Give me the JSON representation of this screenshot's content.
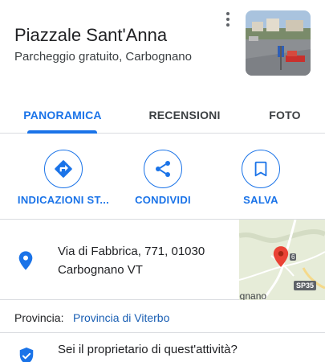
{
  "place": {
    "title": "Piazzale Sant'Anna",
    "subtitle": "Parcheggio gratuito, Carbognano"
  },
  "tabs": [
    {
      "label": "PANORAMICA",
      "active": true
    },
    {
      "label": "RECENSIONI",
      "active": false
    },
    {
      "label": "FOTO",
      "active": false
    }
  ],
  "actions": [
    {
      "label": "INDICAZIONI ST...",
      "icon": "directions-icon"
    },
    {
      "label": "CONDIVIDI",
      "icon": "share-icon"
    },
    {
      "label": "SALVA",
      "icon": "bookmark-icon"
    }
  ],
  "address": {
    "line1": "Via di Fabbrica, 771, 01030",
    "line2": "Carbognano VT"
  },
  "map": {
    "road_label": "SP35",
    "num_label": "6",
    "town_label": "ognano"
  },
  "province": {
    "label": "Provincia:",
    "link": "Provincia di Viterbo"
  },
  "owner": {
    "text": "Sei il proprietario di quest'attività?"
  },
  "colors": {
    "accent": "#1a73e8",
    "text": "#202124",
    "divider": "#dadce0",
    "map_pin": "#ea4335"
  }
}
